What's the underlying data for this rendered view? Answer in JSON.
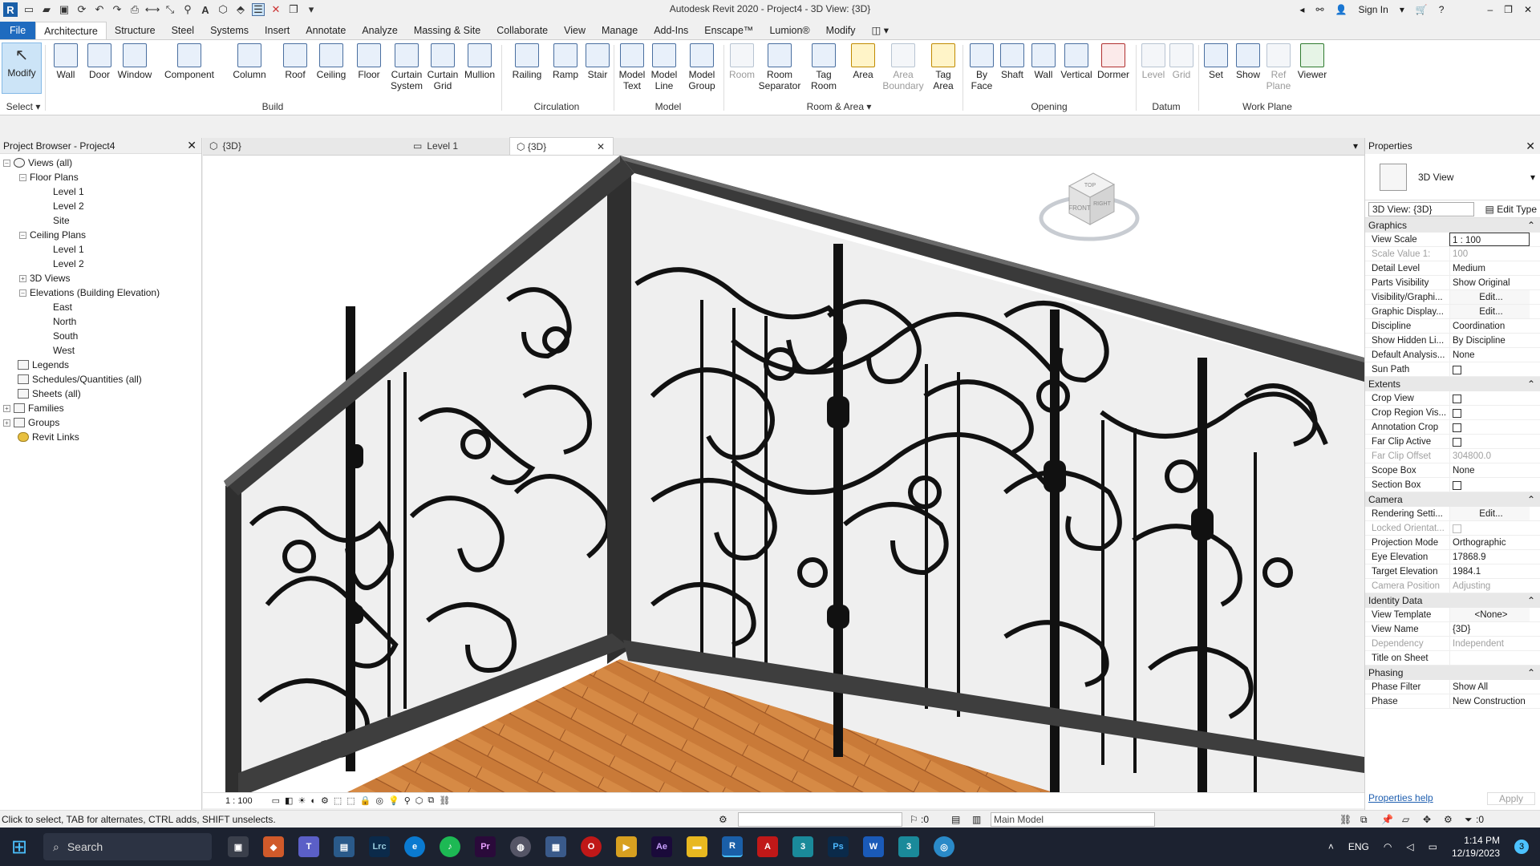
{
  "title_bar": {
    "title": "Autodesk Revit 2020 - Project4 - 3D View: {3D}",
    "sign_in": "Sign In"
  },
  "menu": {
    "tabs": [
      "File",
      "Architecture",
      "Structure",
      "Steel",
      "Systems",
      "Insert",
      "Annotate",
      "Analyze",
      "Massing & Site",
      "Collaborate",
      "View",
      "Manage",
      "Add-Ins",
      "Enscape™",
      "Lumion®",
      "Modify"
    ]
  },
  "ribbon": {
    "modify": "Modify",
    "select": "Select",
    "build": {
      "label": "Build",
      "items": [
        "Wall",
        "Door",
        "Window",
        "Component",
        "Column",
        "Roof",
        "Ceiling",
        "Floor",
        "Curtain System",
        "Curtain Grid",
        "Mullion"
      ]
    },
    "circulation": {
      "label": "Circulation",
      "items": [
        "Railing",
        "Ramp",
        "Stair"
      ]
    },
    "model": {
      "label": "Model",
      "items": [
        "Model Text",
        "Model Line",
        "Model Group"
      ]
    },
    "room_area": {
      "label": "Room & Area",
      "items": [
        "Room",
        "Room Separator",
        "Tag Room",
        "Area",
        "Area Boundary",
        "Tag Area"
      ]
    },
    "opening": {
      "label": "Opening",
      "items": [
        "By Face",
        "Shaft",
        "Wall",
        "Vertical",
        "Dormer"
      ]
    },
    "datum": {
      "label": "Datum",
      "items": [
        "Level",
        "Grid"
      ]
    },
    "work_plane": {
      "label": "Work Plane",
      "items": [
        "Set",
        "Show",
        "Ref Plane",
        "Viewer"
      ]
    }
  },
  "project_browser": {
    "title": "Project Browser - Project4",
    "nodes": [
      "Views (all)",
      "Floor Plans",
      "Level 1",
      "Level 2",
      "Site",
      "Ceiling Plans",
      "Level 1",
      "Level 2",
      "3D Views",
      "Elevations (Building Elevation)",
      "East",
      "North",
      "South",
      "West",
      "Legends",
      "Schedules/Quantities (all)",
      "Sheets (all)",
      "Families",
      "Groups",
      "Revit Links"
    ]
  },
  "view_tabs": [
    "{3D}",
    "Level 1",
    "{3D}"
  ],
  "view_control": {
    "scale": "1 : 100"
  },
  "viewcube": {
    "top": "TOP",
    "front": "FRONT",
    "right": "RIGHT"
  },
  "properties": {
    "title": "Properties",
    "type_name": "3D View",
    "selector": "3D View: {3D}",
    "edit_type": "Edit Type",
    "groups": [
      {
        "name": "Graphics",
        "rows": [
          {
            "label": "View Scale",
            "value": "1 : 100",
            "kind": "boxed"
          },
          {
            "label": "Scale Value    1:",
            "value": "100",
            "kind": "dim"
          },
          {
            "label": "Detail Level",
            "value": "Medium"
          },
          {
            "label": "Parts Visibility",
            "value": "Show Original"
          },
          {
            "label": "Visibility/Graphi...",
            "value": "Edit...",
            "kind": "btn"
          },
          {
            "label": "Graphic Display...",
            "value": "Edit...",
            "kind": "btn"
          },
          {
            "label": "Discipline",
            "value": "Coordination"
          },
          {
            "label": "Show Hidden Li...",
            "value": "By Discipline"
          },
          {
            "label": "Default Analysis...",
            "value": "None"
          },
          {
            "label": "Sun Path",
            "value": "",
            "kind": "chk"
          }
        ]
      },
      {
        "name": "Extents",
        "rows": [
          {
            "label": "Crop View",
            "value": "",
            "kind": "chk"
          },
          {
            "label": "Crop Region Vis...",
            "value": "",
            "kind": "chk"
          },
          {
            "label": "Annotation Crop",
            "value": "",
            "kind": "chk"
          },
          {
            "label": "Far Clip Active",
            "value": "",
            "kind": "chk"
          },
          {
            "label": "Far Clip Offset",
            "value": "304800.0",
            "kind": "dim"
          },
          {
            "label": "Scope Box",
            "value": "None"
          },
          {
            "label": "Section Box",
            "value": "",
            "kind": "chk"
          }
        ]
      },
      {
        "name": "Camera",
        "rows": [
          {
            "label": "Rendering Setti...",
            "value": "Edit...",
            "kind": "btn"
          },
          {
            "label": "Locked Orientat...",
            "value": "",
            "kind": "dimchk"
          },
          {
            "label": "Projection Mode",
            "value": "Orthographic"
          },
          {
            "label": "Eye Elevation",
            "value": "17868.9"
          },
          {
            "label": "Target Elevation",
            "value": "1984.1"
          },
          {
            "label": "Camera Position",
            "value": "Adjusting",
            "kind": "dim"
          }
        ]
      },
      {
        "name": "Identity Data",
        "rows": [
          {
            "label": "View Template",
            "value": "<None>",
            "kind": "btn"
          },
          {
            "label": "View Name",
            "value": "{3D}"
          },
          {
            "label": "Dependency",
            "value": "Independent",
            "kind": "dim"
          },
          {
            "label": "Title on Sheet",
            "value": ""
          }
        ]
      },
      {
        "name": "Phasing",
        "rows": [
          {
            "label": "Phase Filter",
            "value": "Show All"
          },
          {
            "label": "Phase",
            "value": "New Construction"
          }
        ]
      }
    ],
    "help": "Properties help",
    "apply": "Apply"
  },
  "status_bar": {
    "message": "Click to select, TAB for alternates, CTRL adds, SHIFT unselects.",
    "workset_count": ":0",
    "model": "Main Model",
    "filter_count": ":0"
  },
  "taskbar": {
    "search": "Search",
    "apps": [
      "Lrc",
      "Pr",
      "Ae",
      "R",
      "A",
      "3",
      "Ps",
      "W",
      "3"
    ],
    "lang": "ENG",
    "time": "1:14 PM",
    "date": "12/19/2023",
    "badge": "3"
  }
}
